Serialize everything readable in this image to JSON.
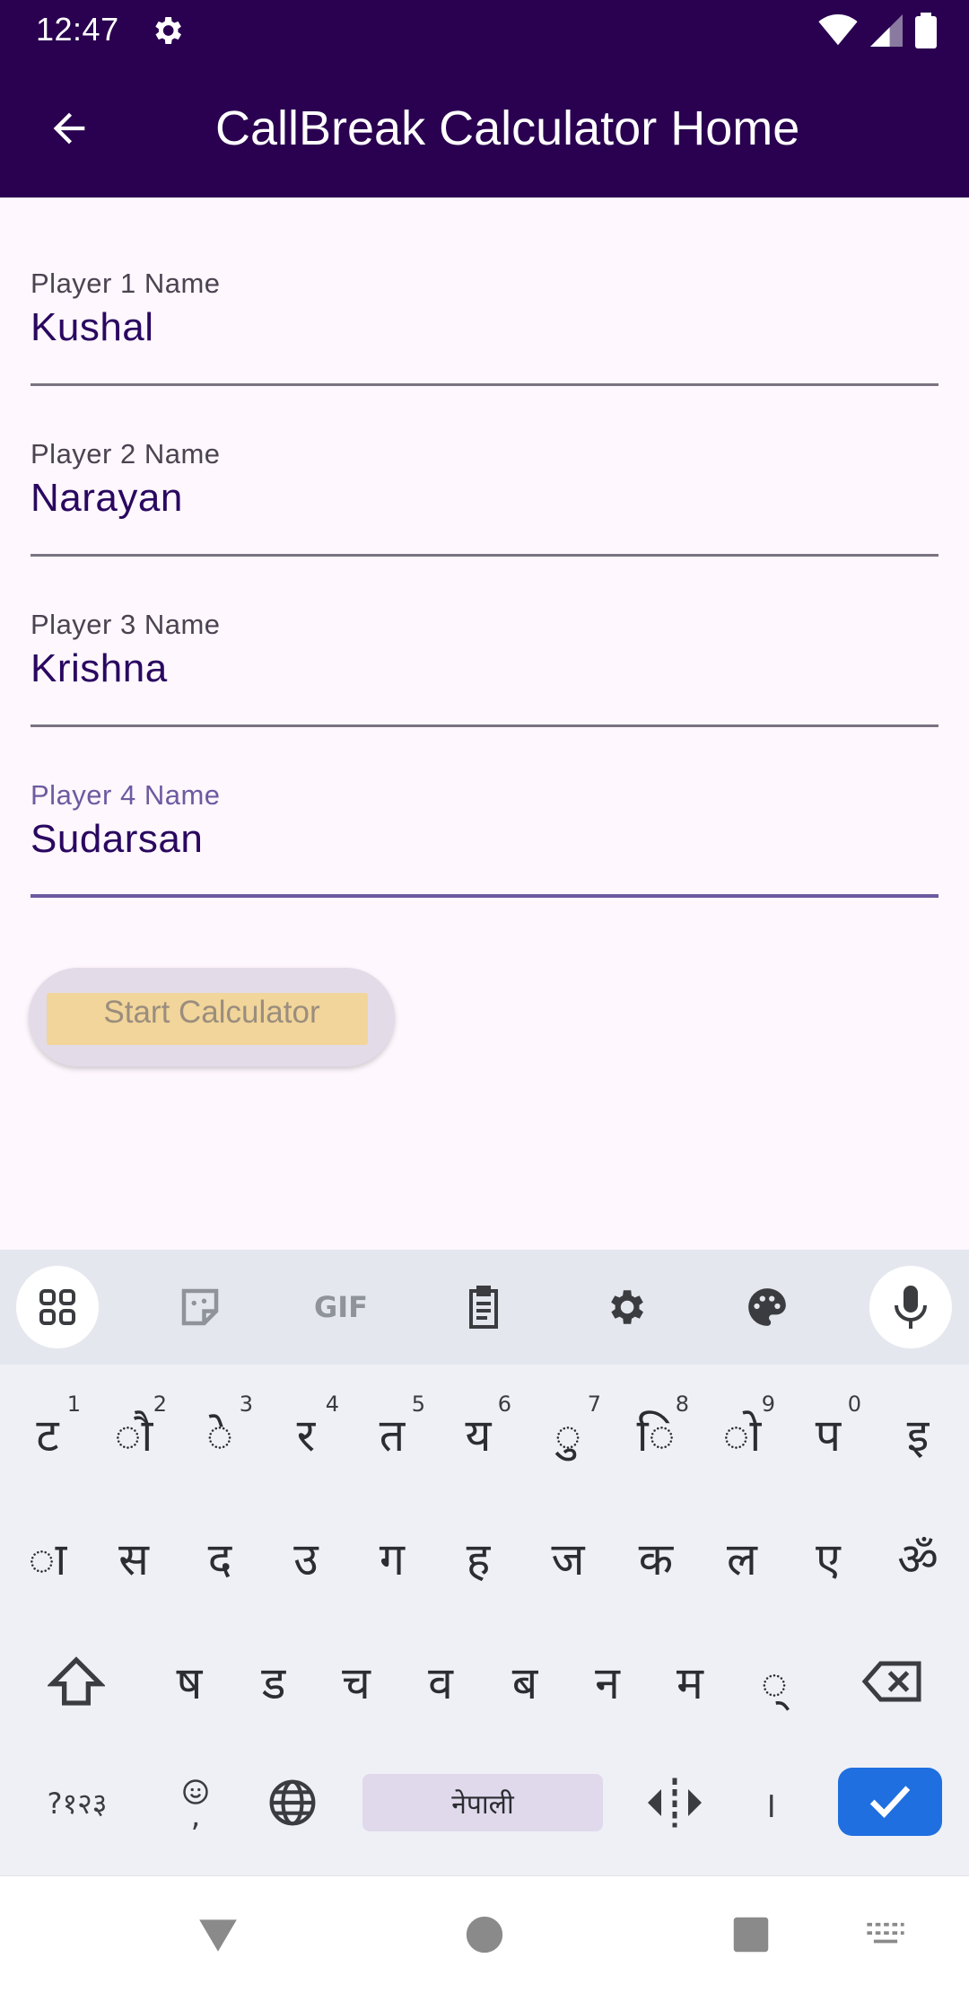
{
  "status": {
    "time": "12:47"
  },
  "appbar": {
    "title": "CallBreak Calculator Home"
  },
  "fields": [
    {
      "label": "Player 1 Name",
      "value": "Kushal"
    },
    {
      "label": "Player 2 Name",
      "value": "Narayan"
    },
    {
      "label": "Player 3 Name",
      "value": "Krishna"
    },
    {
      "label": "Player 4 Name",
      "value": "Sudarsan"
    }
  ],
  "start_button": {
    "label": "Start Calculator"
  },
  "keyboard": {
    "toolbar": {
      "gif_label": "GIF"
    },
    "row1": [
      {
        "char": "ट",
        "hint": "1"
      },
      {
        "char": "ौ",
        "hint": "2"
      },
      {
        "char": "े",
        "hint": "3"
      },
      {
        "char": "र",
        "hint": "4"
      },
      {
        "char": "त",
        "hint": "5"
      },
      {
        "char": "य",
        "hint": "6"
      },
      {
        "char": "ु",
        "hint": "7"
      },
      {
        "char": "ि",
        "hint": "8"
      },
      {
        "char": "ो",
        "hint": "9"
      },
      {
        "char": "प",
        "hint": "0"
      },
      {
        "char": "इ",
        "hint": ""
      }
    ],
    "row2": [
      "ा",
      "स",
      "द",
      "उ",
      "ग",
      "ह",
      "ज",
      "क",
      "ल",
      "ए",
      "ॐ"
    ],
    "row3": [
      "ष",
      "ड",
      "च",
      "व",
      "ब",
      "न",
      "म",
      "्"
    ],
    "symbols_label": "?१२३",
    "emoji_comma": ",",
    "space_label": "नेपाली",
    "danda": "।"
  },
  "colors": {
    "appbar": "#2a0050",
    "accent": "#6d5aa0",
    "enter_key": "#1f6fe0"
  }
}
